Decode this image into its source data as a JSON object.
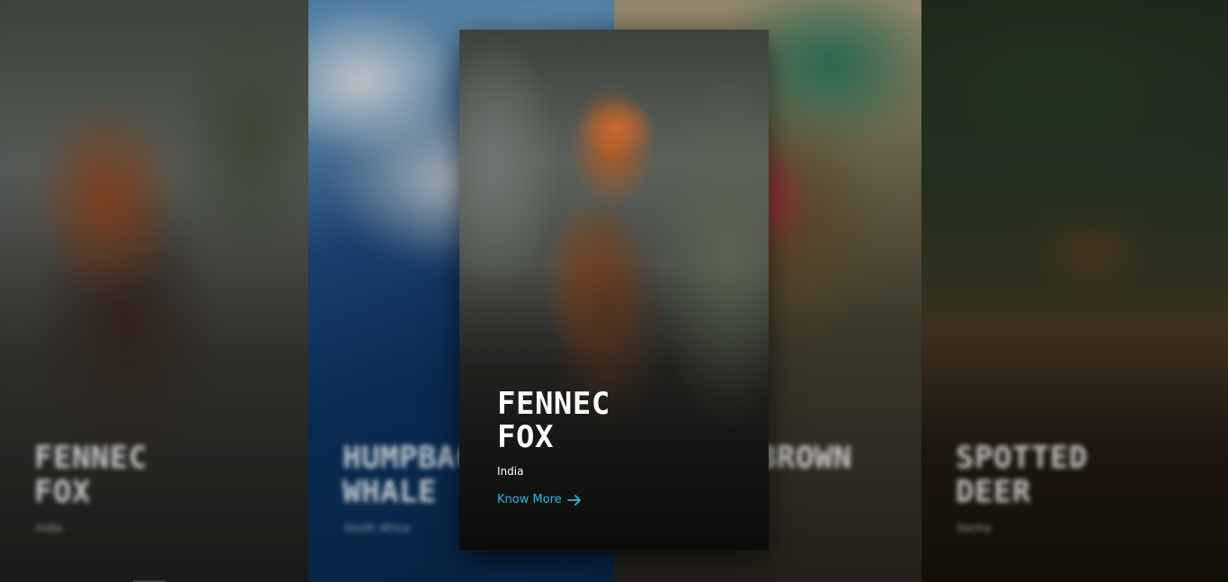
{
  "slides": [
    {
      "title_line1": "Fennec",
      "title_line2": "Fox",
      "location": "India"
    },
    {
      "title_line1": "Humpback",
      "title_line2": "Whale",
      "location": "South Africa"
    },
    {
      "title_line1": "Brown",
      "title_line2": "",
      "location": ""
    },
    {
      "title_line1": "Spotted",
      "title_line2": "Deer",
      "location": "Kanha"
    }
  ],
  "active": {
    "title_line1": "FENNEC",
    "title_line2": "FOX",
    "location": "India",
    "cta_label": "Know More",
    "cta_icon": "arrow-right-icon"
  },
  "colors": {
    "accent": "#1ebfe9"
  }
}
